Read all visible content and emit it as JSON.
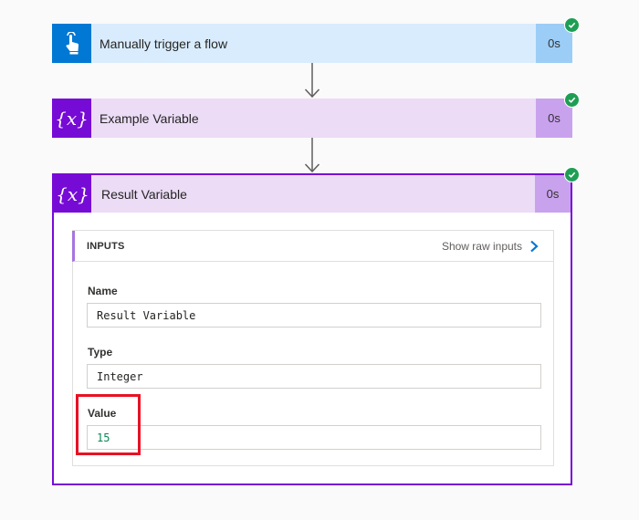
{
  "steps": [
    {
      "title": "Manually trigger a flow",
      "duration": "0s",
      "icon": "touch-hand-icon",
      "status": "succeeded"
    },
    {
      "title": "Example Variable",
      "duration": "0s",
      "icon": "variable-icon",
      "status": "succeeded"
    },
    {
      "title": "Result Variable",
      "duration": "0s",
      "icon": "variable-icon",
      "status": "succeeded"
    }
  ],
  "icon_glyph": {
    "variable": "{x}"
  },
  "inputs": {
    "header": "INPUTS",
    "show_raw": "Show raw inputs",
    "fields": [
      {
        "label": "Name",
        "value": "Result Variable"
      },
      {
        "label": "Type",
        "value": "Integer"
      },
      {
        "label": "Value",
        "value": "15"
      }
    ]
  },
  "colors": {
    "trigger_accent": "#0078d4",
    "variable_accent": "#770bd6",
    "success": "#1e9e54",
    "highlight": "#e81123"
  }
}
